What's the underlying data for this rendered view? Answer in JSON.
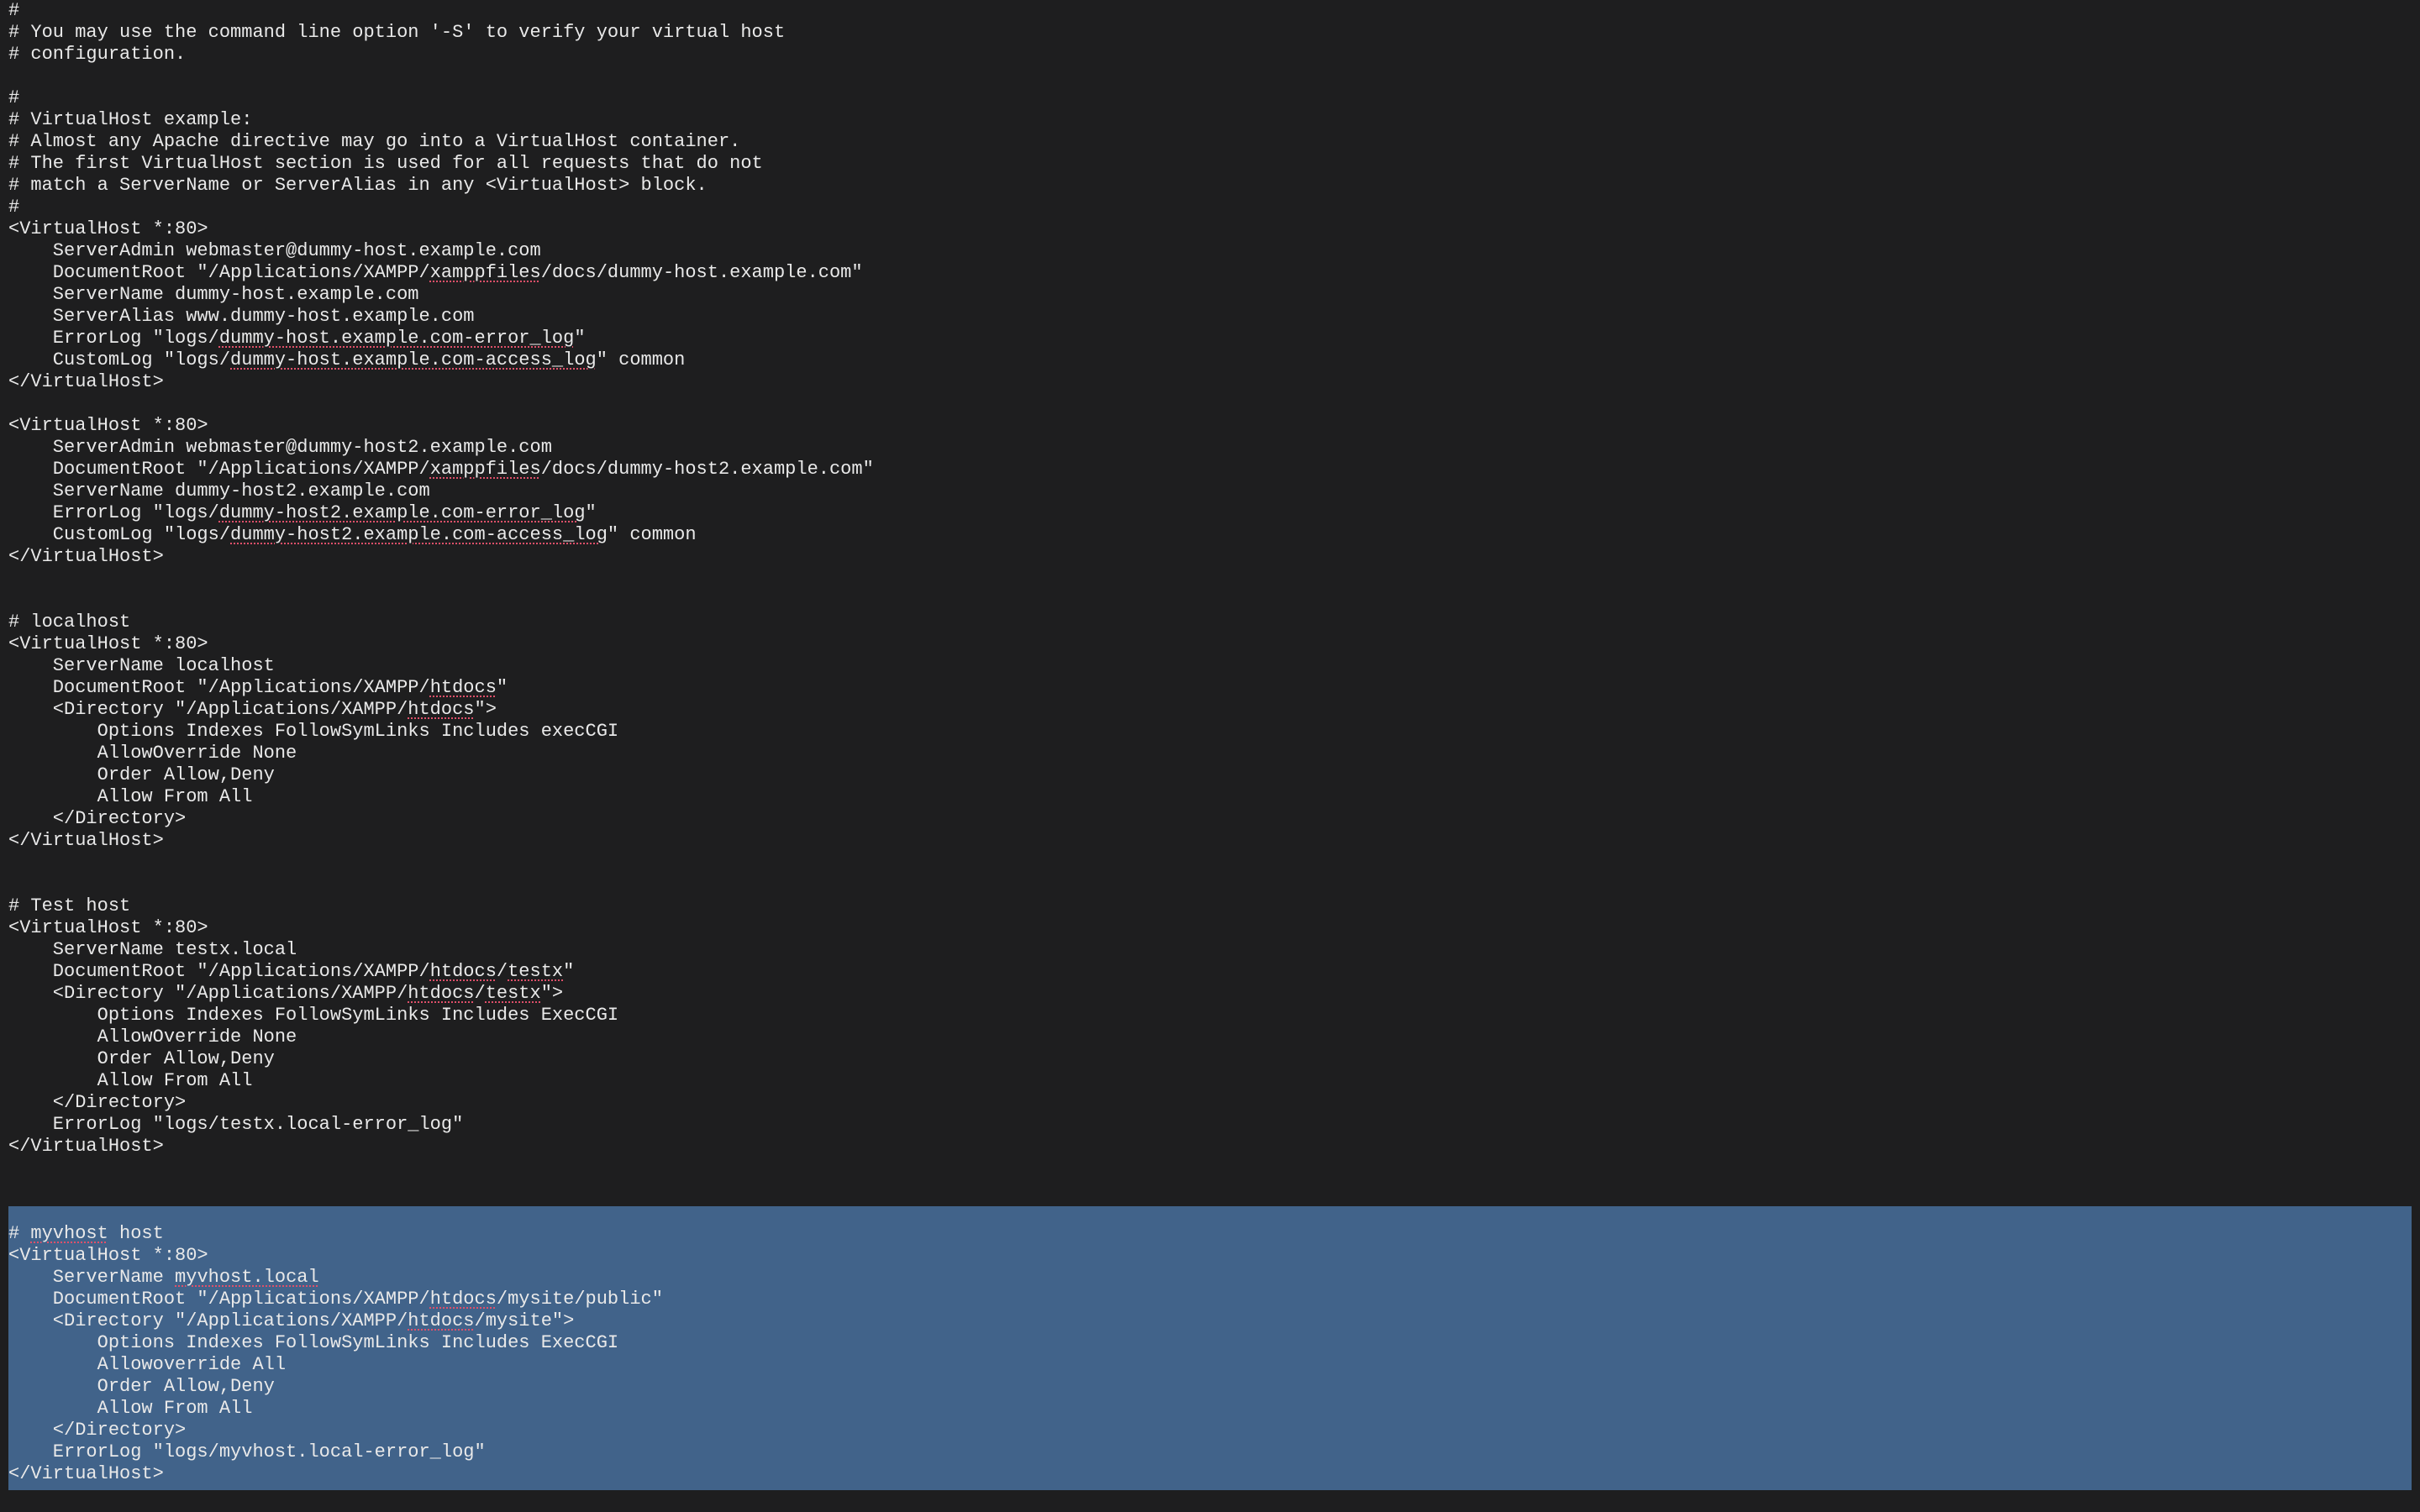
{
  "editor": {
    "lines": [
      [
        {
          "t": "#"
        }
      ],
      [
        {
          "t": "# You may use the command line option '-S' to verify your virtual host"
        }
      ],
      [
        {
          "t": "# configuration."
        }
      ],
      [
        {
          "t": ""
        }
      ],
      [
        {
          "t": "#"
        }
      ],
      [
        {
          "t": "# VirtualHost example:"
        }
      ],
      [
        {
          "t": "# Almost any Apache directive may go into a VirtualHost container."
        }
      ],
      [
        {
          "t": "# The first VirtualHost section is used for all requests that do not"
        }
      ],
      [
        {
          "t": "# match a ServerName or ServerAlias in any <VirtualHost> block."
        }
      ],
      [
        {
          "t": "#"
        }
      ],
      [
        {
          "t": "<VirtualHost *:80>"
        }
      ],
      [
        {
          "t": "    ServerAdmin webmaster@dummy-host.example.com"
        }
      ],
      [
        {
          "t": "    DocumentRoot \"/Applications/XAMPP/"
        },
        {
          "t": "xamppfiles",
          "s": true
        },
        {
          "t": "/docs/dummy-host.example.com\""
        }
      ],
      [
        {
          "t": "    ServerName dummy-host.example.com"
        }
      ],
      [
        {
          "t": "    ServerAlias www.dummy-host.example.com"
        }
      ],
      [
        {
          "t": "    ErrorLog \"logs/"
        },
        {
          "t": "dummy-host.example.com-error_log",
          "s": true
        },
        {
          "t": "\""
        }
      ],
      [
        {
          "t": "    CustomLog \"logs/"
        },
        {
          "t": "dummy-host.example.com-access_log",
          "s": true
        },
        {
          "t": "\" common"
        }
      ],
      [
        {
          "t": "</VirtualHost>"
        }
      ],
      [
        {
          "t": ""
        }
      ],
      [
        {
          "t": "<VirtualHost *:80>"
        }
      ],
      [
        {
          "t": "    ServerAdmin webmaster@dummy-host2.example.com"
        }
      ],
      [
        {
          "t": "    DocumentRoot \"/Applications/XAMPP/"
        },
        {
          "t": "xamppfiles",
          "s": true
        },
        {
          "t": "/docs/dummy-host2.example.com\""
        }
      ],
      [
        {
          "t": "    ServerName dummy-host2.example.com"
        }
      ],
      [
        {
          "t": "    ErrorLog \"logs/"
        },
        {
          "t": "dummy-host2.example.com-error_log",
          "s": true
        },
        {
          "t": "\""
        }
      ],
      [
        {
          "t": "    CustomLog \"logs/"
        },
        {
          "t": "dummy-host2.example.com-access_log",
          "s": true
        },
        {
          "t": "\" common"
        }
      ],
      [
        {
          "t": "</VirtualHost>"
        }
      ],
      [
        {
          "t": ""
        }
      ],
      [
        {
          "t": ""
        }
      ],
      [
        {
          "t": "# localhost"
        }
      ],
      [
        {
          "t": "<VirtualHost *:80>"
        }
      ],
      [
        {
          "t": "    ServerName localhost"
        }
      ],
      [
        {
          "t": "    DocumentRoot \"/Applications/XAMPP/"
        },
        {
          "t": "htdocs",
          "s": true
        },
        {
          "t": "\""
        }
      ],
      [
        {
          "t": "    <Directory \"/Applications/XAMPP/"
        },
        {
          "t": "htdocs",
          "s": true
        },
        {
          "t": "\">"
        }
      ],
      [
        {
          "t": "        Options Indexes FollowSymLinks Includes execCGI"
        }
      ],
      [
        {
          "t": "        AllowOverride None"
        }
      ],
      [
        {
          "t": "        Order Allow,Deny"
        }
      ],
      [
        {
          "t": "        Allow From All"
        }
      ],
      [
        {
          "t": "    </Directory>"
        }
      ],
      [
        {
          "t": "</VirtualHost>"
        }
      ],
      [
        {
          "t": ""
        }
      ],
      [
        {
          "t": ""
        }
      ],
      [
        {
          "t": "# Test host"
        }
      ],
      [
        {
          "t": "<VirtualHost *:80>"
        }
      ],
      [
        {
          "t": "    ServerName testx.local"
        }
      ],
      [
        {
          "t": "    DocumentRoot \"/Applications/XAMPP/"
        },
        {
          "t": "htdocs",
          "s": true
        },
        {
          "t": "/"
        },
        {
          "t": "testx",
          "s": true
        },
        {
          "t": "\""
        }
      ],
      [
        {
          "t": "    <Directory \"/Applications/XAMPP/"
        },
        {
          "t": "htdocs",
          "s": true
        },
        {
          "t": "/"
        },
        {
          "t": "testx",
          "s": true
        },
        {
          "t": "\">"
        }
      ],
      [
        {
          "t": "        Options Indexes FollowSymLinks Includes ExecCGI"
        }
      ],
      [
        {
          "t": "        AllowOverride None"
        }
      ],
      [
        {
          "t": "        Order Allow,Deny"
        }
      ],
      [
        {
          "t": "        Allow From All"
        }
      ],
      [
        {
          "t": "    </Directory>"
        }
      ],
      [
        {
          "t": "    ErrorLog \"logs/testx.local-error_log\""
        }
      ],
      [
        {
          "t": "</VirtualHost>"
        }
      ],
      [
        {
          "t": ""
        }
      ],
      [
        {
          "t": ""
        }
      ],
      [
        {
          "t": ""
        }
      ],
      [
        {
          "t": "# "
        },
        {
          "t": "myvhost",
          "s": true
        },
        {
          "t": " host"
        }
      ],
      [
        {
          "t": "<VirtualHost *:80>"
        }
      ],
      [
        {
          "t": "    ServerName "
        },
        {
          "t": "myvhost.local",
          "s": true
        }
      ],
      [
        {
          "t": "    DocumentRoot \"/Applications/XAMPP/"
        },
        {
          "t": "htdocs",
          "s": true
        },
        {
          "t": "/mysite/public\""
        }
      ],
      [
        {
          "t": "    <Directory \"/Applications/XAMPP/"
        },
        {
          "t": "htdocs",
          "s": true
        },
        {
          "t": "/mysite\">"
        }
      ],
      [
        {
          "t": "        Options Indexes FollowSymLinks Includes ExecCGI"
        }
      ],
      [
        {
          "t": "        Allowoverride All"
        }
      ],
      [
        {
          "t": "        Order Allow,Deny"
        }
      ],
      [
        {
          "t": "        Allow From All"
        }
      ],
      [
        {
          "t": "    </Directory>"
        }
      ],
      [
        {
          "t": "    ErrorLog \"logs/myvhost.local-error_log\""
        }
      ],
      [
        {
          "t": "</VirtualHost>"
        }
      ]
    ]
  },
  "colors": {
    "background": "#1e1e1f",
    "text": "#e9e9e9",
    "selection": "#41638a",
    "spellcheck_underline": "#e0506a"
  }
}
